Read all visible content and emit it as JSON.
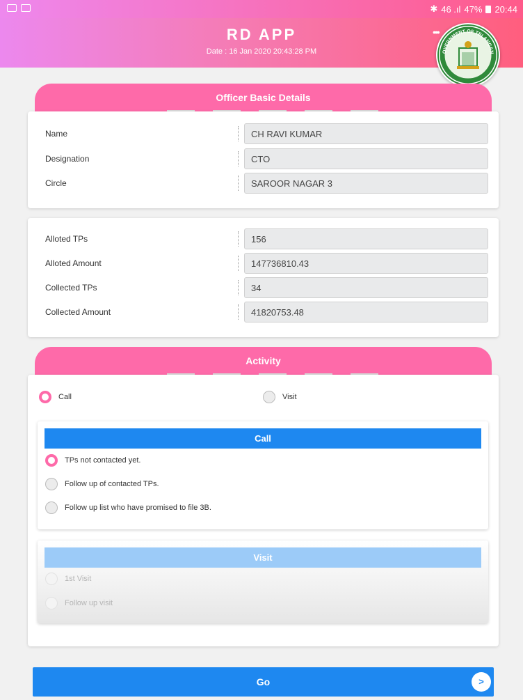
{
  "status_bar": {
    "signal": "46 .ıl",
    "battery": "47%",
    "time": "20:44"
  },
  "header": {
    "title": "RD APP",
    "date": "Date : 16 Jan 2020 20:43:28 PM",
    "emblem_text": "GOVERNMENT OF TELANGANA"
  },
  "officer": {
    "tab_label": "Officer Basic Details",
    "fields": [
      {
        "label": "Name",
        "value": "CH RAVI KUMAR"
      },
      {
        "label": "Designation",
        "value": "CTO"
      },
      {
        "label": "Circle",
        "value": "SAROOR NAGAR 3"
      }
    ]
  },
  "stats": {
    "fields": [
      {
        "label": "Alloted TPs",
        "value": "156"
      },
      {
        "label": "Alloted Amount",
        "value": "147736810.43"
      },
      {
        "label": "Collected TPs",
        "value": "34"
      },
      {
        "label": "Collected Amount",
        "value": "41820753.48"
      }
    ]
  },
  "activity": {
    "tab_label": "Activity",
    "options": [
      {
        "label": "Call",
        "selected": true
      },
      {
        "label": "Visit",
        "selected": false
      }
    ],
    "call_panel": {
      "title": "Call",
      "options": [
        {
          "label": "TPs not contacted yet.",
          "selected": true
        },
        {
          "label": "Follow up of contacted TPs.",
          "selected": false
        },
        {
          "label": "Follow up list who have promised to file 3B.",
          "selected": false
        }
      ]
    },
    "visit_panel": {
      "title": "Visit",
      "options": [
        {
          "label": "1st Visit",
          "selected": false
        },
        {
          "label": "Follow up visit",
          "selected": false
        }
      ]
    }
  },
  "go_button": {
    "label": "Go",
    "arrow": ">"
  },
  "colors": {
    "accent_pink": "#fe6aa9",
    "primary_blue": "#1e88f0",
    "disabled_blue": "#9ccbf8"
  }
}
